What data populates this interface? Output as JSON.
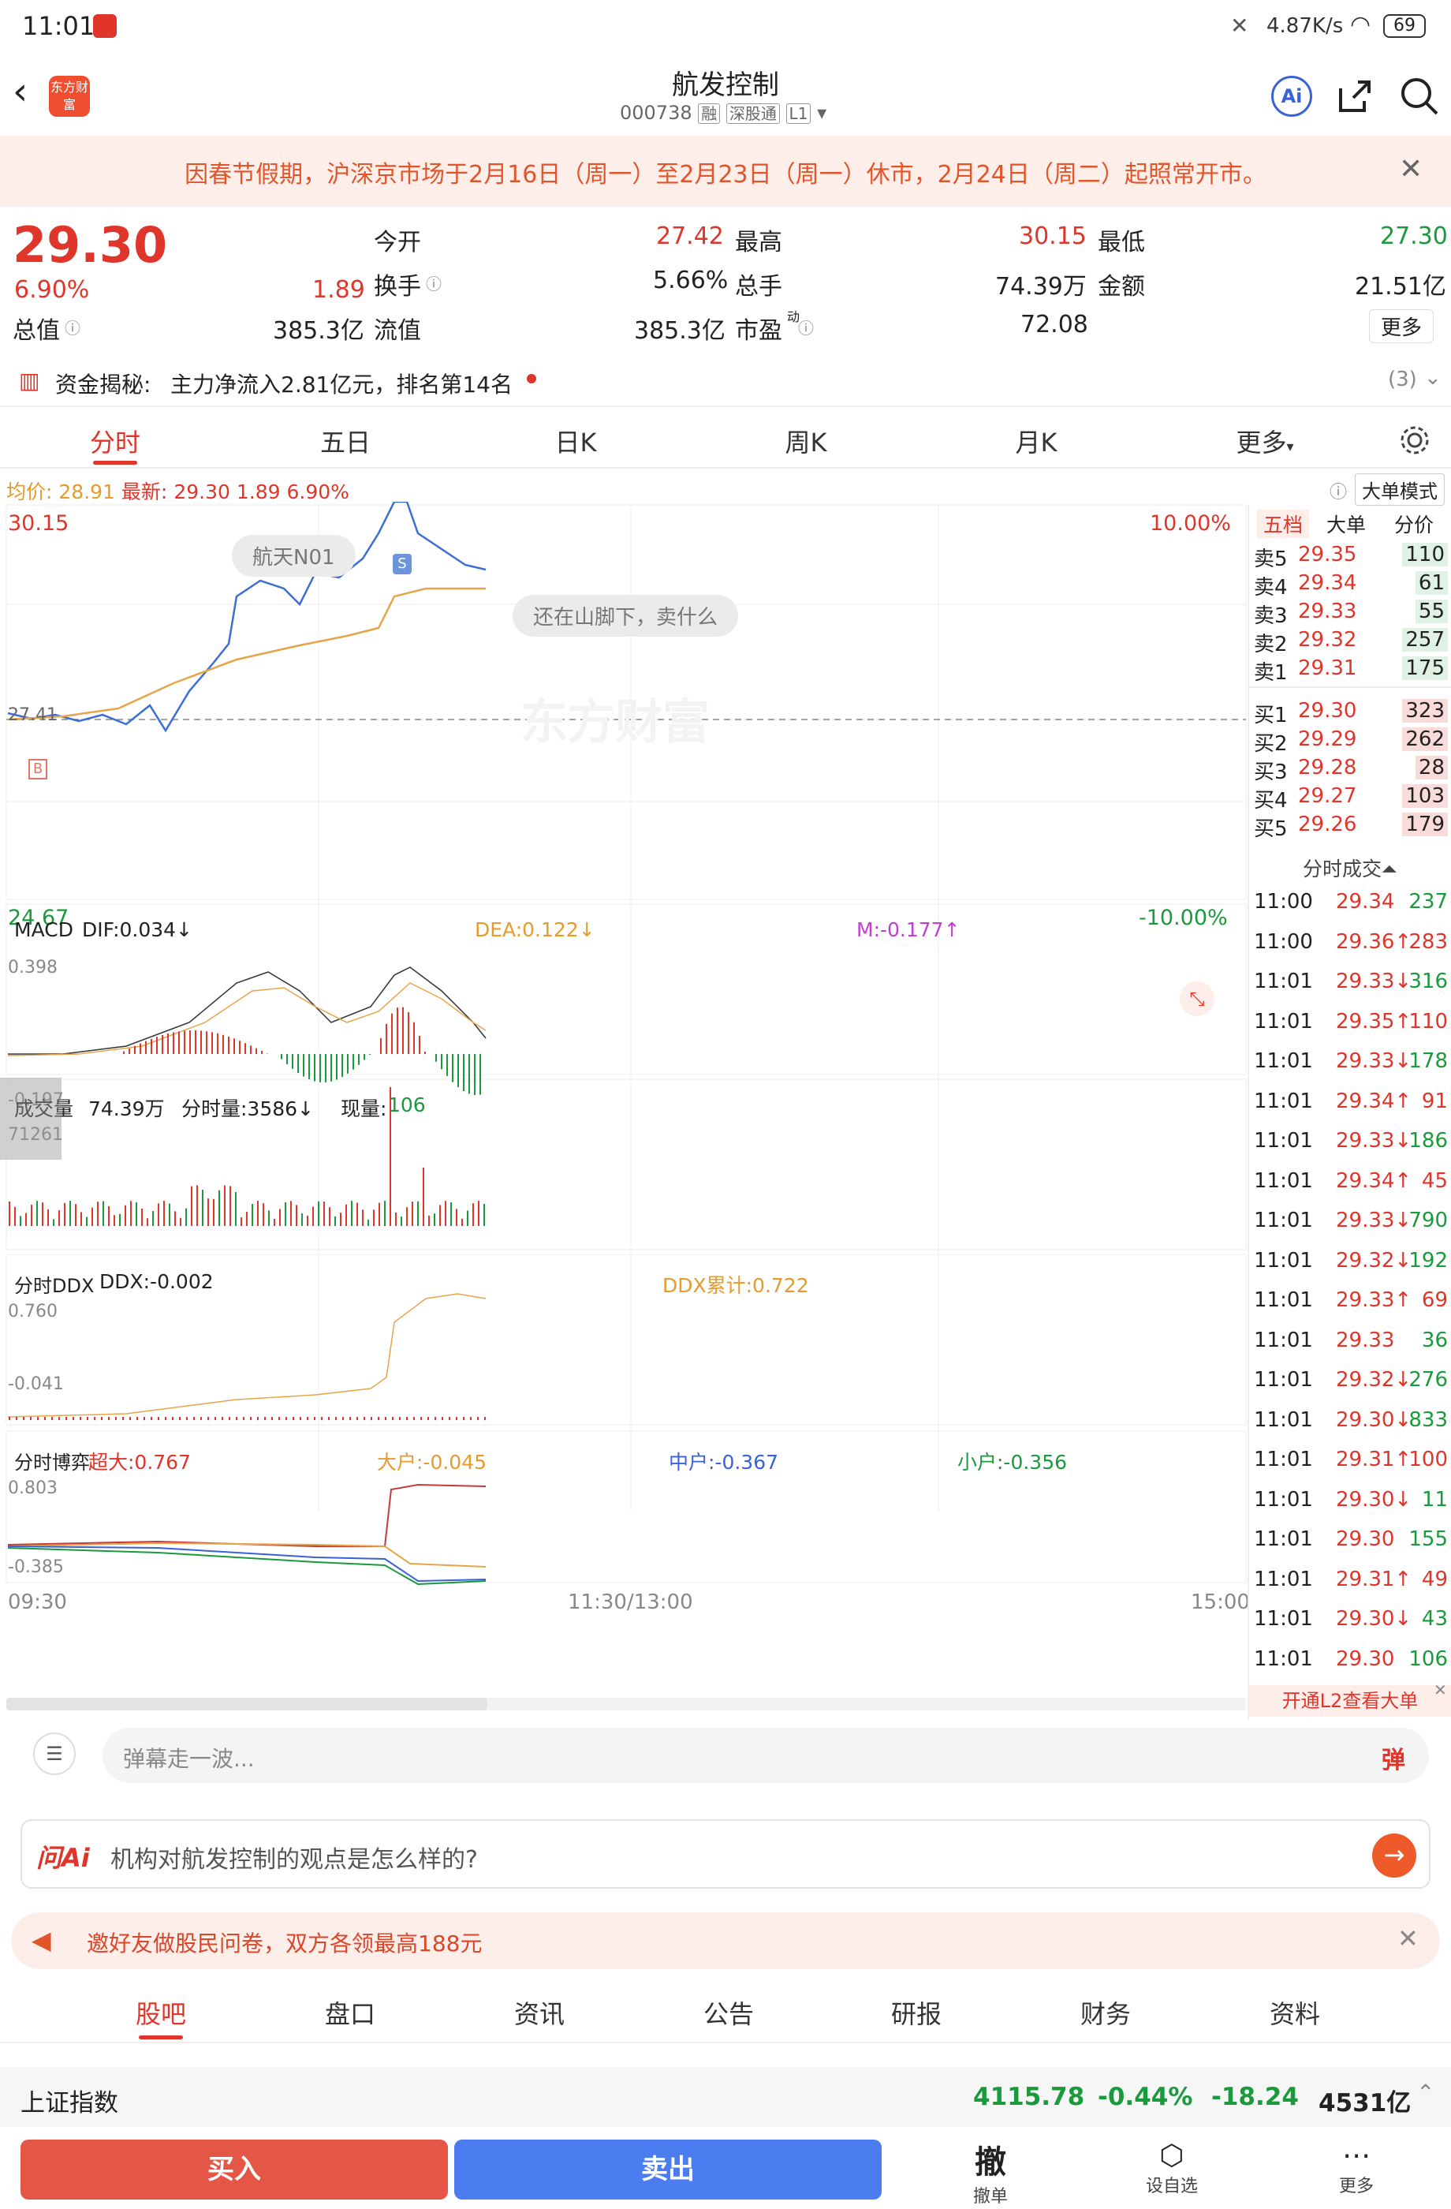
{
  "status_bar": {
    "time": "11:01",
    "net_speed": "4.87K/s",
    "battery": "69"
  },
  "header": {
    "logo_text": "东方财富",
    "stock_name": "航发控制",
    "stock_code": "000738",
    "tags": [
      "融",
      "深股通",
      "L1"
    ]
  },
  "notice": {
    "text": "因春节假期，沪深京市场于2月16日（周一）至2月23日（周一）休市，2月24日（周二）起照常开市。"
  },
  "quote": {
    "price": "29.30",
    "change_pct": "6.90%",
    "change": "1.89",
    "today_open_label": "今开",
    "today_open": "27.42",
    "high_label": "最高",
    "high": "30.15",
    "low_label": "最低",
    "low": "27.30",
    "turnover_label": "换手",
    "turnover": "5.66%",
    "volume_label": "总手",
    "volume": "74.39万",
    "amount_label": "金额",
    "amount": "21.51亿",
    "mktcap_label": "总值",
    "mktcap": "385.3亿",
    "float_cap_label": "流值",
    "float_cap": "385.3亿",
    "pe_label": "市盈",
    "pe_sup": "动",
    "pe": "72.08",
    "more_label": "更多"
  },
  "fund_flow": {
    "label": "资金揭秘:",
    "text": "主力净流入2.81亿元，排名第14名",
    "count": "(3)"
  },
  "chart_tabs": [
    "分时",
    "五日",
    "日K",
    "周K",
    "月K",
    "更多"
  ],
  "chart_header": {
    "avg_label": "均价:",
    "avg": "28.91",
    "latest_label": "最新:",
    "latest": "29.30",
    "latest_change": "1.89",
    "latest_pct": "6.90%",
    "mode_label": "大单模式"
  },
  "price_chart": {
    "y_top": "30.15",
    "y_bottom": "24.67",
    "pct_top": "10.00%",
    "pct_bottom": "-10.00%",
    "ref_price": "27.41",
    "chip1": "航天N01",
    "chip2": "还在山脚下，卖什么",
    "watermark": "东方财富",
    "marker_buy": "B",
    "marker_sell": "S"
  },
  "macd": {
    "name": "MACD",
    "dif": "DIF:0.034↓",
    "dea": "DEA:0.122↓",
    "m": "M:-0.177↑",
    "y_top": "0.398",
    "y_bottom": "-0.197"
  },
  "volume": {
    "name": "成交量",
    "total": "74.39万",
    "minute": "分时量:3586↓",
    "now_label": "现量:",
    "now": "106",
    "y_top": "71261"
  },
  "ddx": {
    "name": "分时DDX",
    "ddx": "DDX:-0.002",
    "ddx_sum": "DDX累计:0.722",
    "y_top": "0.760",
    "y_bottom": "-0.041"
  },
  "game": {
    "name": "分时博弈",
    "super": "超大:0.767",
    "large": "大户:-0.045",
    "mid": "中户:-0.367",
    "small": "小户:-0.356",
    "y_top": "0.803",
    "y_bottom": "-0.385"
  },
  "time_axis": [
    "09:30",
    "11:30/13:00",
    "15:00"
  ],
  "order_book": {
    "tabs": [
      "五档",
      "大单",
      "分价"
    ],
    "asks": [
      {
        "label": "卖5",
        "price": "29.35",
        "vol": "110"
      },
      {
        "label": "卖4",
        "price": "29.34",
        "vol": "61"
      },
      {
        "label": "卖3",
        "price": "29.33",
        "vol": "55"
      },
      {
        "label": "卖2",
        "price": "29.32",
        "vol": "257"
      },
      {
        "label": "卖1",
        "price": "29.31",
        "vol": "175"
      }
    ],
    "bids": [
      {
        "label": "买1",
        "price": "29.30",
        "vol": "323"
      },
      {
        "label": "买2",
        "price": "29.29",
        "vol": "262"
      },
      {
        "label": "买3",
        "price": "29.28",
        "vol": "28"
      },
      {
        "label": "买4",
        "price": "29.27",
        "vol": "103"
      },
      {
        "label": "买5",
        "price": "29.26",
        "vol": "179"
      }
    ],
    "ticks_title": "分时成交",
    "ticks": [
      {
        "time": "11:00",
        "price": "29.34",
        "vol": "237",
        "dir": ""
      },
      {
        "time": "11:00",
        "price": "29.36↑",
        "vol": "283",
        "dir": "up"
      },
      {
        "time": "11:01",
        "price": "29.33↓",
        "vol": "316",
        "dir": "down"
      },
      {
        "time": "11:01",
        "price": "29.35↑",
        "vol": "110",
        "dir": "up"
      },
      {
        "time": "11:01",
        "price": "29.33↓",
        "vol": "178",
        "dir": "down"
      },
      {
        "time": "11:01",
        "price": "29.34↑",
        "vol": "91",
        "dir": "up"
      },
      {
        "time": "11:01",
        "price": "29.33↓",
        "vol": "186",
        "dir": "down"
      },
      {
        "time": "11:01",
        "price": "29.34↑",
        "vol": "45",
        "dir": "up"
      },
      {
        "time": "11:01",
        "price": "29.33↓",
        "vol": "790",
        "dir": "down"
      },
      {
        "time": "11:01",
        "price": "29.32↓",
        "vol": "192",
        "dir": "down"
      },
      {
        "time": "11:01",
        "price": "29.33↑",
        "vol": "69",
        "dir": "up"
      },
      {
        "time": "11:01",
        "price": "29.33",
        "vol": "36",
        "dir": ""
      },
      {
        "time": "11:01",
        "price": "29.32↓",
        "vol": "276",
        "dir": "down"
      },
      {
        "time": "11:01",
        "price": "29.30↓",
        "vol": "833",
        "dir": "down"
      },
      {
        "time": "11:01",
        "price": "29.31↑",
        "vol": "100",
        "dir": "up"
      },
      {
        "time": "11:01",
        "price": "29.30↓",
        "vol": "11",
        "dir": "down"
      },
      {
        "time": "11:01",
        "price": "29.30",
        "vol": "155",
        "dir": ""
      },
      {
        "time": "11:01",
        "price": "29.31↑",
        "vol": "49",
        "dir": "up"
      },
      {
        "time": "11:01",
        "price": "29.30↓",
        "vol": "43",
        "dir": "down"
      },
      {
        "time": "11:01",
        "price": "29.30",
        "vol": "106",
        "dir": ""
      }
    ],
    "l2_label": "开通L2查看大单"
  },
  "bullet": {
    "placeholder": "弹幕走一波...",
    "btn": "弹"
  },
  "ask_ai": {
    "logo": "问Ai",
    "question": "机构对航发控制的观点是怎么样的?"
  },
  "promo": {
    "text": "邀好友做股民问卷，双方各领最高188元"
  },
  "bottom_tabs": [
    "股吧",
    "盘口",
    "资讯",
    "公告",
    "研报",
    "财务",
    "资料"
  ],
  "index_bar": {
    "name": "上证指数",
    "value": "4115.78",
    "pct": "-0.44%",
    "change": "-18.24",
    "amount": "4531亿"
  },
  "actions": {
    "buy": "买入",
    "sell": "卖出",
    "cancel": "撤",
    "cancel_sub": "撤单",
    "alert": "设自选",
    "more": "更多"
  }
}
